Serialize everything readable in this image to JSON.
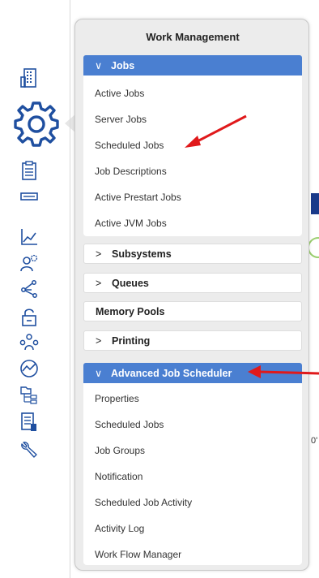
{
  "panel": {
    "title": "Work Management",
    "sections": [
      {
        "label": "Jobs",
        "expanded": true,
        "items": [
          "Active Jobs",
          "Server Jobs",
          "Scheduled Jobs",
          "Job Descriptions",
          "Active Prestart Jobs",
          "Active JVM Jobs"
        ]
      },
      {
        "label": "Subsystems",
        "expanded": false
      },
      {
        "label": "Queues",
        "expanded": false
      },
      {
        "label": "Memory Pools"
      },
      {
        "label": "Printing",
        "expanded": false
      },
      {
        "label": "Advanced Job Scheduler",
        "expanded": true,
        "items": [
          "Properties",
          "Scheduled Jobs",
          "Job Groups",
          "Notification",
          "Scheduled Job Activity",
          "Activity Log",
          "Work Flow Manager"
        ]
      }
    ]
  },
  "background_fragment": "0'",
  "colors": {
    "accent": "#4a7fd1",
    "icon": "#1f4fa0",
    "annotation_arrow": "#e0191b"
  },
  "rail_icons": [
    "building-icon",
    "gear-icon",
    "clipboard-icon",
    "drive-icon",
    "line-chart-icon",
    "user-settings-icon",
    "network-share-icon",
    "lock-icon",
    "users-icon",
    "performance-icon",
    "folder-tree-icon",
    "document-list-icon",
    "wrench-icon"
  ]
}
